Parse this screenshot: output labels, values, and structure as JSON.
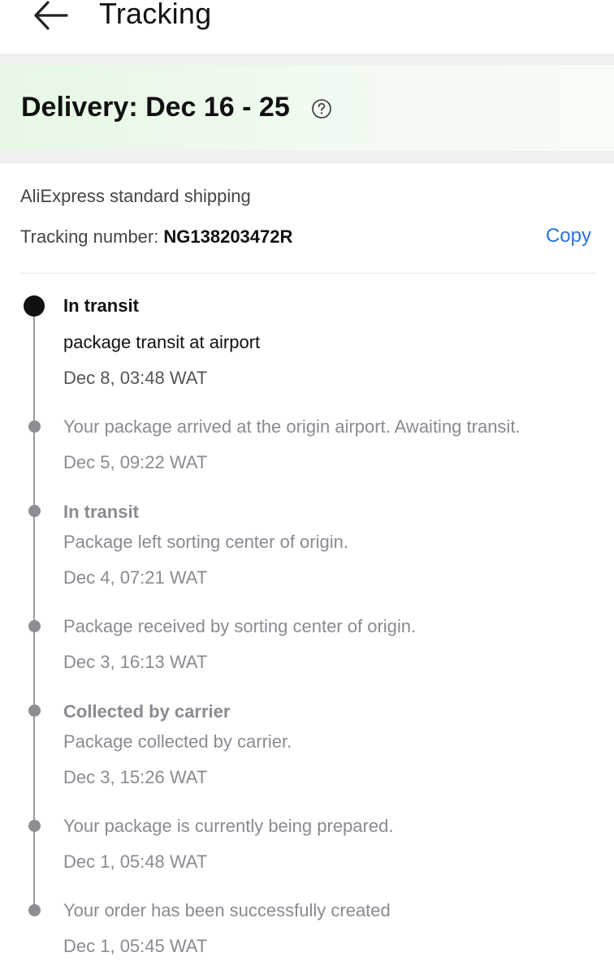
{
  "header": {
    "title": "Tracking",
    "back_icon": "arrow-left-icon"
  },
  "delivery": {
    "title": "Delivery: Dec 16 - 25",
    "help_icon": "question-circle-icon",
    "background": "#e6f8e4"
  },
  "shipping": {
    "method": "AliExpress standard shipping",
    "tracking_label": "Tracking number:",
    "tracking_number": "NG138203472R",
    "copy_label": "Copy",
    "accent_color": "#2b73dc"
  },
  "events": [
    {
      "title": "In transit",
      "description": "package transit at airport",
      "time": "Dec 8, 03:48 WAT",
      "active": true
    },
    {
      "title": "",
      "description": "Your package arrived at the origin airport. Awaiting transit.",
      "time": "Dec 5, 09:22 WAT",
      "active": false
    },
    {
      "title": "In transit",
      "description": "Package left sorting center of origin.",
      "time": "Dec 4, 07:21 WAT",
      "active": false
    },
    {
      "title": "",
      "description": "Package received by sorting center of origin.",
      "time": "Dec 3, 16:13 WAT",
      "active": false
    },
    {
      "title": "Collected by carrier",
      "description": "Package collected by carrier.",
      "time": "Dec 3, 15:26 WAT",
      "active": false
    },
    {
      "title": "",
      "description": "Your package is currently being prepared.",
      "time": "Dec 1, 05:48 WAT",
      "active": false
    },
    {
      "title": "",
      "description": "Your order has been successfully created",
      "time": "Dec 1, 05:45 WAT",
      "active": false
    }
  ]
}
